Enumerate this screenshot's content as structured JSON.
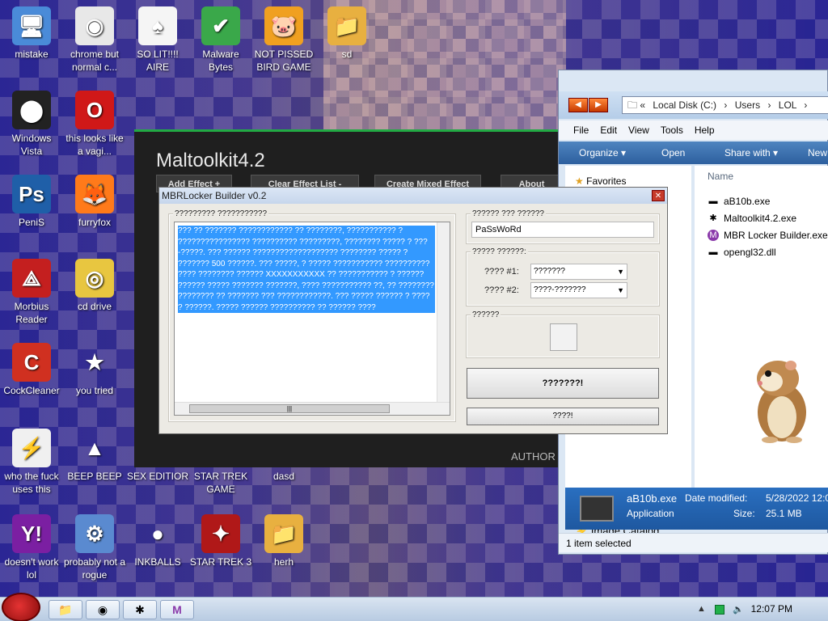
{
  "desktop": {
    "icons": [
      {
        "label": "mistake",
        "glyph": "🖥",
        "color": "#4a8bd8"
      },
      {
        "label": "chrome but normal c...",
        "glyph": "◉",
        "color": "#e8e8e8"
      },
      {
        "label": "SO LIT!!!! AIRE",
        "glyph": "♠",
        "color": "#f5f5f5"
      },
      {
        "label": "Malware Bytes",
        "glyph": "✔",
        "color": "#3aa84a"
      },
      {
        "label": "NOT PISSED BIRD GAME",
        "glyph": "🐷",
        "color": "#f0a020"
      },
      {
        "label": "sd",
        "glyph": "📁",
        "color": "#e8b040"
      },
      {
        "label": "Windows Vista",
        "glyph": "⬤",
        "color": "#222"
      },
      {
        "label": "this looks like a vagi...",
        "glyph": "O",
        "color": "#d01818"
      },
      {
        "label": "PeniS",
        "glyph": "Ps",
        "color": "#1f5fa8"
      },
      {
        "label": "furryfox",
        "glyph": "🦊",
        "color": "#ff7a1a"
      },
      {
        "label": "Morbius Reader",
        "glyph": "⟁",
        "color": "#c41f1f"
      },
      {
        "label": "cd drive",
        "glyph": "◎",
        "color": "#e8c640"
      },
      {
        "label": "CockCleaner",
        "glyph": "C",
        "color": "#d03020"
      },
      {
        "label": "you tried",
        "glyph": "★",
        "color": "transparent"
      },
      {
        "label": "who the fuck uses this",
        "glyph": "⚡",
        "color": "#f0f0f0"
      },
      {
        "label": "BEEP BEEP",
        "glyph": "▲",
        "color": "transparent"
      },
      {
        "label": "SEX EDITIOR",
        "glyph": "",
        "color": "transparent"
      },
      {
        "label": "STAR TREK GAME",
        "glyph": "",
        "color": "transparent"
      },
      {
        "label": "dasd",
        "glyph": "",
        "color": "transparent"
      },
      {
        "label": "doesn't work lol",
        "glyph": "Y!",
        "color": "#7b1fa2"
      },
      {
        "label": "probably not a rogue",
        "glyph": "⚙",
        "color": "#5a8ad0"
      },
      {
        "label": "INKBALLS",
        "glyph": "●",
        "color": "transparent"
      },
      {
        "label": "STAR TREK 3",
        "glyph": "✦",
        "color": "#b01818"
      },
      {
        "label": "herh",
        "glyph": "📁",
        "color": "#e8b040"
      }
    ]
  },
  "maltoolkit": {
    "title": "Maltoolkit4.2",
    "buttons": [
      "Add Effect +",
      "Clear Effect List -",
      "Create Mixed Effect",
      "About"
    ],
    "author": "AUTHOR"
  },
  "explorer": {
    "address": [
      "«",
      "Local Disk (C:)",
      "›",
      "Users",
      "›",
      "LOL",
      "›"
    ],
    "menu": [
      "File",
      "Edit",
      "View",
      "Tools",
      "Help"
    ],
    "commands": [
      "Organize ▾",
      "Open",
      "Share with ▾",
      "New"
    ],
    "favorites": "Favorites",
    "image_catalog": "Image Catalog",
    "column": "Name",
    "files": [
      {
        "name": "aB10b.exe",
        "icon": "▬"
      },
      {
        "name": "Maltoolkit4.2.exe",
        "icon": "✱"
      },
      {
        "name": "MBR Locker Builder.exe",
        "icon": "M"
      },
      {
        "name": "opengl32.dll",
        "icon": "▬"
      }
    ],
    "details": {
      "name": "aB10b.exe",
      "type": "Application",
      "date_label": "Date modified:",
      "date_value": "5/28/2022 12:0",
      "size_label": "Size:",
      "size_value": "25.1 MB"
    },
    "status": "1 item selected"
  },
  "mbr": {
    "title": "MBRLocker Builder v0.2",
    "close": "✕",
    "message_group": "????????? ???????????",
    "message_text": "??? ?? ??????? ???????????? ?? ????????, ??????????? ? ???????????????? ?????????? ?????????, ???????? ????? ? ???-?????. ??? ?????? ??????????????????? ???????? ????? ? ??????? 500 ??????. ??? ?????, ? ????? ??????????? ?????????? ???? ???????? ?????? XXXXXXXXXXX ?? ??????????? ? ?????? ?????? ????? ??????? ???????, ???? ??????????? ??, ?? ???????? ???????? ?? ??????? ??? ????????????. ??? ????? ?????? ? ???? ? ??????. ????? ?????? ?????????? ?? ?????? ????",
    "password_group": "?????? ??? ??????",
    "password_value": "PaSsWoRd",
    "colors_group": "????? ??????:",
    "color1_label": "???? #1:",
    "color1_value": "???????",
    "color2_label": "???? #2:",
    "color2_value": "????-???????",
    "icon_group": "??????",
    "build_button": "???????!",
    "exit_button": "????!"
  },
  "taskbar": {
    "clock": "12:07 PM",
    "items": [
      "📁",
      "◉",
      "✱",
      "M"
    ]
  }
}
